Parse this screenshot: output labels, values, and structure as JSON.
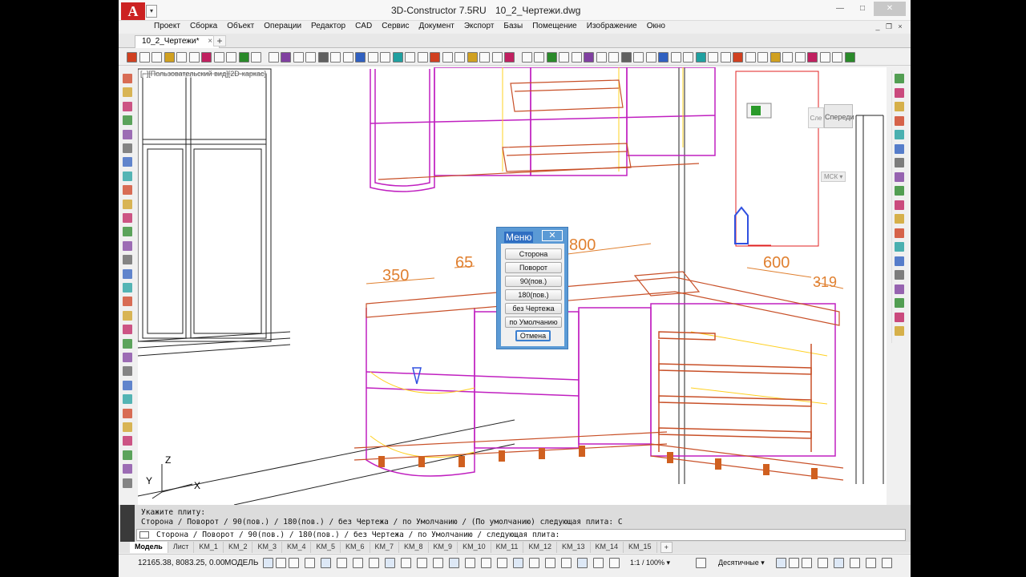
{
  "window": {
    "app_title": "3D-Constructor 7.5RU",
    "file_title": "10_2_Чертежи.dwg",
    "logo_letter": "A",
    "btn_min": "—",
    "btn_max": "□",
    "btn_close": "✕"
  },
  "menu": [
    "Проект",
    "Сборка",
    "Объект",
    "Операции",
    "Редактор",
    "CAD",
    "Сервис",
    "Документ",
    "Экспорт",
    "Базы",
    "Помещение",
    "Изображение",
    "Окно"
  ],
  "mdi": {
    "min": "_",
    "restore": "❐",
    "close": "×"
  },
  "doc_tab": {
    "label": "10_2_Чертежи*",
    "close": "×",
    "add": "+"
  },
  "viewport": {
    "view_label": "[−][Пользовательский вид][2D-каркас]",
    "viewcube_front": "Спереди",
    "viewcube_left": "Сле",
    "wcs": "МСК ▾",
    "axis_x": "X",
    "axis_y": "Y",
    "axis_z": "Z",
    "dims": [
      "350",
      "65",
      "800",
      "600",
      "319"
    ]
  },
  "dialog": {
    "title": "Меню",
    "close": "✕",
    "buttons": [
      "Сторона",
      "Поворот",
      "90(пов.)",
      "180(пов.)",
      "без Чертежа",
      "по Умолчанию"
    ],
    "cancel": "Отмена"
  },
  "command": {
    "line1": "Укажите плиту:",
    "line2": "Сторона / Поворот / 90(пов.) / 180(пов.) / без Чертежа / по Умолчанию / (По умолчанию) следующая плита: С",
    "input": "Сторона / Поворот / 90(пов.) / 180(пов.) / без Чертежа / по Умолчанию /  следующая плита:"
  },
  "layout_tabs": [
    "Модель",
    "Лист",
    "KM_1",
    "KM_2",
    "KM_3",
    "KM_4",
    "KM_5",
    "KM_6",
    "KM_7",
    "KM_8",
    "KM_9",
    "KM_10",
    "KM_11",
    "KM_12",
    "KM_13",
    "KM_14",
    "KM_15"
  ],
  "layout_add": "+",
  "status": {
    "coords": "12165.38, 8083.25, 0.00",
    "model": "МОДЕЛЬ",
    "scale": "1:1 / 100% ▾",
    "units": "Десятичные ▾"
  }
}
